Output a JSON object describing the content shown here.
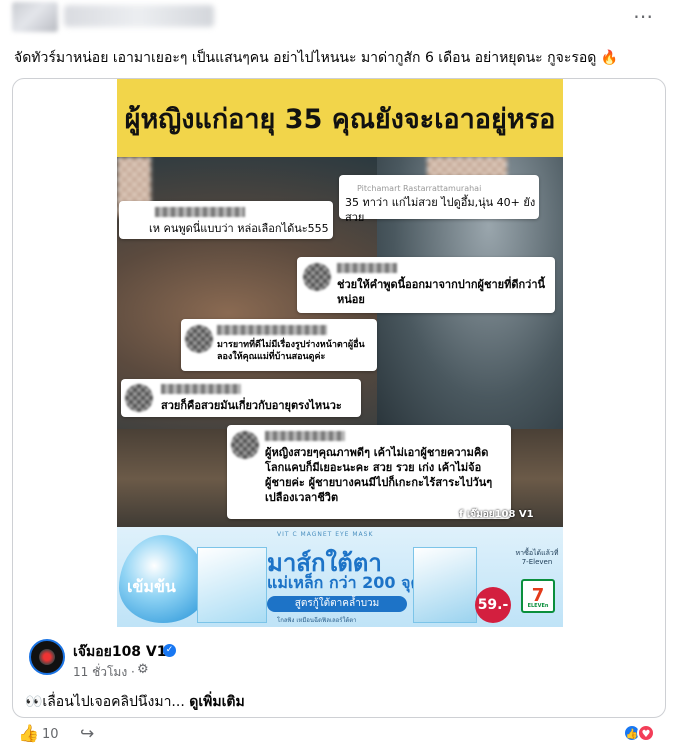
{
  "post": {
    "more_icon": "⋯",
    "caption": "จัดทัวร์มาหน่อย เอามาเยอะๆ เป็นแสนๆคน อย่าไปไหนนะ มาด่ากูสัก 6 เดือน อย่าหยุดนะ กูจะรอดู 🔥"
  },
  "media": {
    "headline": "ผู้หญิงแก่อายุ 35 คุณยังจะเอาอยู่หรอ",
    "comments": [
      {
        "text": "เห คนพูดนี่แบบว่า หล่อเลือกได้นะ555"
      },
      {
        "name_faint": "Pitchamart Rastarrattamurahai",
        "text": "35 ทาว่า แก่ไม่สวย ไปดูอึ้ม,นุ่น 40+ ยังสวย"
      },
      {
        "text": "ช่วยให้คำพูดนี้ออกมาจากปากผู้ชายที่ดีกว่านี้หน่อย"
      },
      {
        "text": "มารยาทที่ดีไม่มีเรื่องรูปร่างหน้าตาผู้อื่น ลองให้คุณแม่ที่บ้านสอนดูค่ะ"
      },
      {
        "text": "สวยก็คือสวยมันเกี่ยวกับอายุตรงไหนวะ"
      },
      {
        "text": "ผู้หญิงสวยๆคุณภาพดีๆ เค้าไม่เอาผู้ชายความคิดโลกแคบก็มีเยอะนะคะ สวย รวย เก่ง เค้าไม่จ้อ ผู้ชายค่ะ ผู้ชายบางคนมีไปก็เกะกะไร้สาระไปวันๆ เปลืองเวลาชีวิต"
      }
    ],
    "watermark": "f เจ๊มอย108 V1",
    "ad": {
      "strong_label": "เข้มข้น",
      "kicker": "VIT C MAGNET EYE MASK",
      "headline": "มาส์กใต้ตา",
      "sub": "แม่เหล็ก กว่า 200 จุด",
      "ribbon": "สูตรกู้ใต้ตาคล้ำบวม",
      "foot": "โกลพิง เหมือนฉีดฟิลเลอร์ใต้ตา",
      "price": "59.-",
      "store_text": "หาซื้อได้แล้วที่ 7-Eleven",
      "store_logo": "7"
    }
  },
  "page": {
    "name": "เจ๊มอย108 V1",
    "verified_icon": "✓",
    "time": "11 ชั่วโมง ·",
    "audience_icon": "⚙",
    "snippet_text": "👀เลื่อนไปเจอคลิปนึงมา... ",
    "see_more": "ดูเพิ่มเติม"
  },
  "actions": {
    "like_icon": "👍",
    "like_count": "10",
    "share_icon": "↪",
    "reaction_like": "👍",
    "reaction_love": "♥"
  }
}
